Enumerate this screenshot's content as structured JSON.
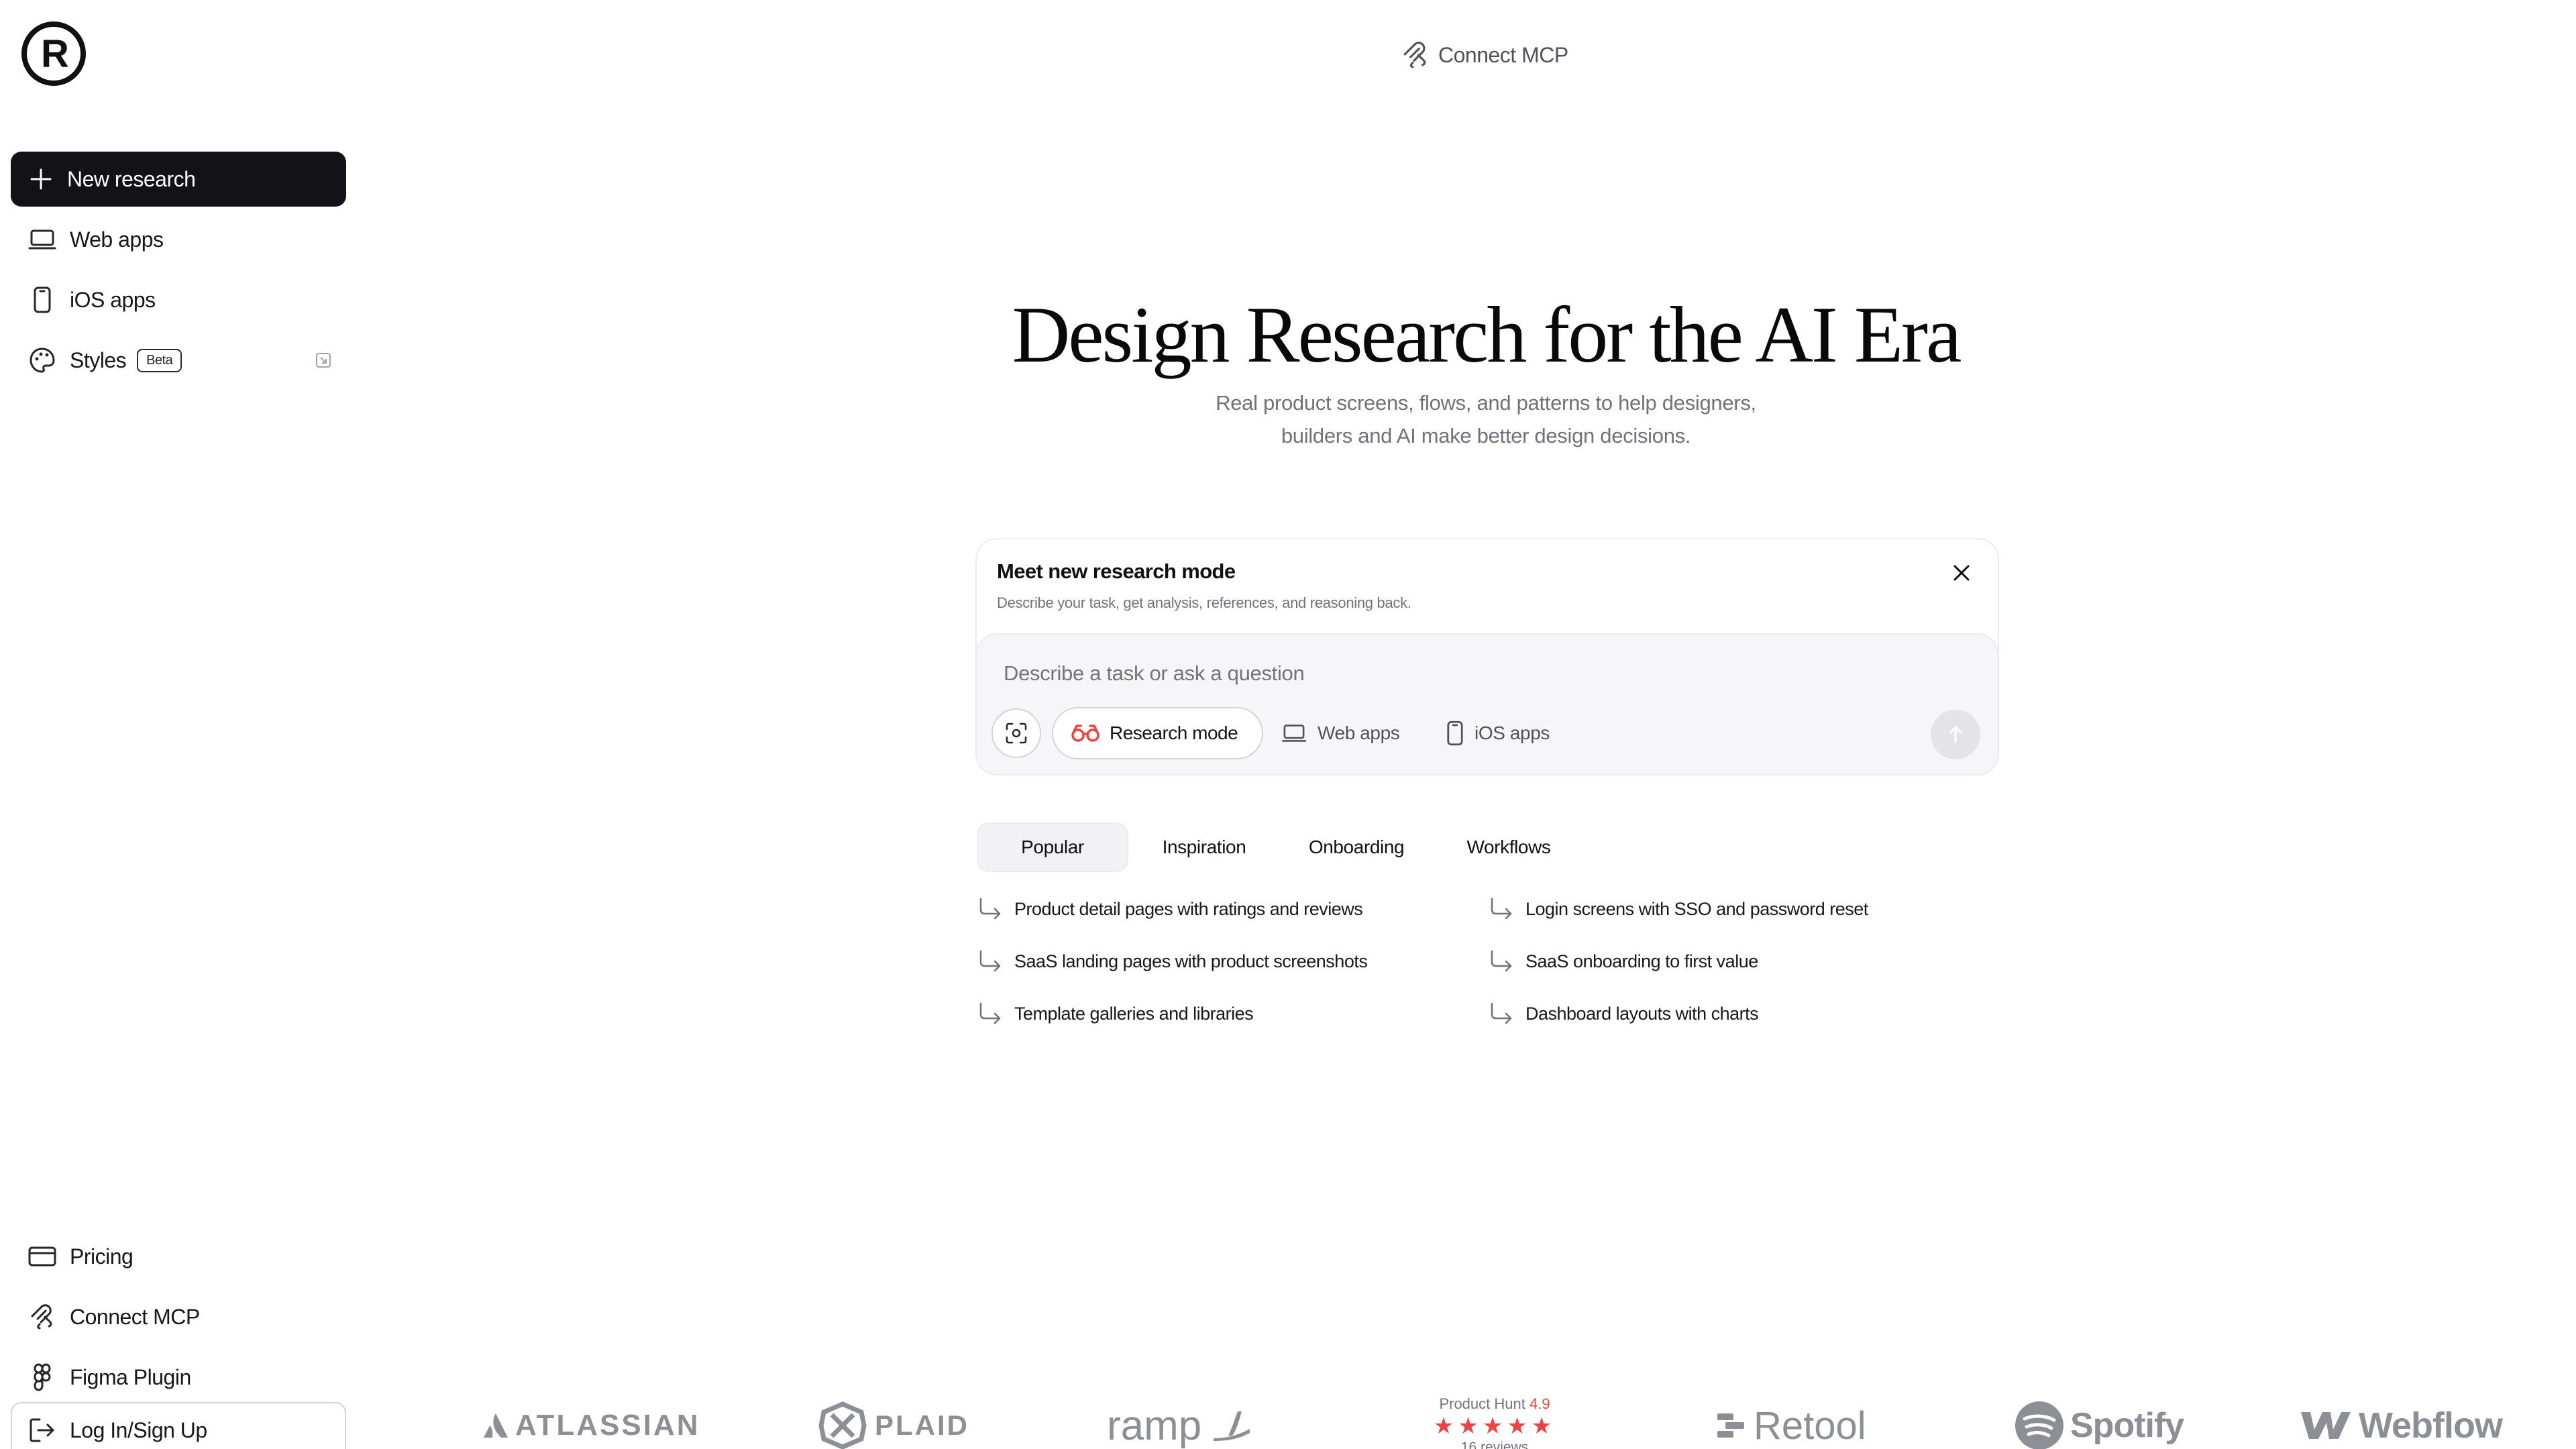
{
  "brand": {
    "logo_letter": "R"
  },
  "header": {
    "connect_label": "Connect MCP"
  },
  "sidebar": {
    "new_research": "New research",
    "items": [
      {
        "label": "Web apps",
        "icon": "laptop-icon"
      },
      {
        "label": "iOS apps",
        "icon": "phone-icon"
      },
      {
        "label": "Styles",
        "icon": "palette-icon",
        "badge": "Beta"
      }
    ],
    "bottom_items": [
      {
        "label": "Pricing",
        "icon": "card-icon"
      },
      {
        "label": "Connect MCP",
        "icon": "mcp-icon"
      },
      {
        "label": "Figma Plugin",
        "icon": "figma-icon"
      }
    ],
    "login": "Log In/Sign Up"
  },
  "hero": {
    "title": "Design Research for the AI Era",
    "subtitle_line1": "Real product screens, flows, and patterns to help designers,",
    "subtitle_line2": "builders and AI make better design decisions."
  },
  "research_card": {
    "title": "Meet new research mode",
    "description": "Describe your task, get analysis, references, and reasoning back.",
    "placeholder": "Describe a task or ask a question",
    "mode_label": "Research mode",
    "chips": [
      "Web apps",
      "iOS apps"
    ]
  },
  "tabs": [
    {
      "label": "Popular",
      "active": true
    },
    {
      "label": "Inspiration",
      "active": false
    },
    {
      "label": "Onboarding",
      "active": false
    },
    {
      "label": "Workflows",
      "active": false
    }
  ],
  "suggestions": [
    "Product detail pages with ratings and reviews",
    "SaaS landing pages with product screenshots",
    "Template galleries and libraries",
    "Login screens with SSO and password reset",
    "SaaS onboarding to first value",
    "Dashboard layouts with charts"
  ],
  "logos": {
    "atlassian": "ATLASSIAN",
    "plaid": "PLAID",
    "ramp": "ramp",
    "product_hunt": {
      "label": "Product Hunt",
      "score": "4.9",
      "stars": "★★★★★",
      "reviews": "16 reviews"
    },
    "retool": "Retool",
    "spotify": "Spotify",
    "webflow": "Webflow"
  },
  "colors": {
    "primary_dark": "#121217",
    "accent_red": "#ef4444",
    "muted_text": "#71717a"
  }
}
